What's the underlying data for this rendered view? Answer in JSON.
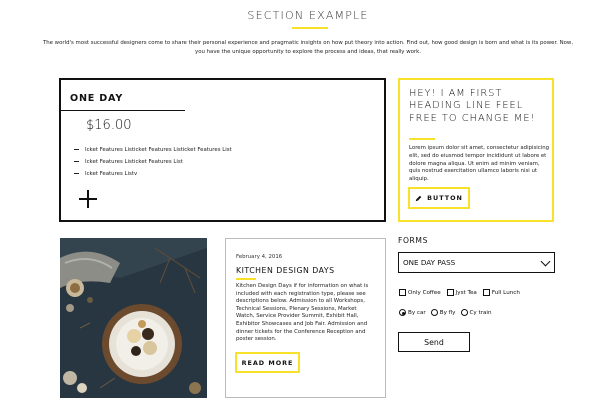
{
  "section": {
    "title": "SECTION EXAMPLE",
    "intro": "The world's most successful designers come to share their personal experience and pragmatic insights on how put theory into action. Find out, how good design is born and what is its power. Now, you have the unique opportunity to explore the process and ideas, that really work."
  },
  "pricing": {
    "title": "ONE DAY",
    "price": "$16.00",
    "features": [
      "Icket Features Listicket Features Listicket Features List",
      "Icket Features Listicket Features List",
      "Icket Features Listv"
    ],
    "plus_icon": "plus-icon"
  },
  "hey": {
    "title": "HEY! I AM FIRST HEADING LINE FEEL FREE TO CHANGE ME!",
    "text": "Lorem ipsum dolor sit amet, consectetur adipisicing elit, sed do eiusmod tempor incididunt ut labore et dolore magna aliqua. Ut enim ad minim veniam, quis nostrud exercitation ullamco laboris nisi ut aliquip.",
    "button_label": "BUTTON",
    "button_icon": "pencil-icon"
  },
  "blog": {
    "date": "February 4, 2016",
    "title": "KITCHEN DESIGN DAYS",
    "text": "Kitchen Design Days if for information on what is included with each registration type, please see descriptions below. Admission to all Workshops, Technical Sessions, Plenary Sessions, Market Watch, Service Provider Summit, Exhibit Hall, Exhibitor Showcases and Job Fair. Admission and dinner tickets for the Conference Reception and poster session.",
    "button_label": "READ MORE"
  },
  "forms": {
    "label": "FORMS",
    "select_value": "ONE DAY PASS",
    "checkboxes": [
      "Only Coffee",
      "Jyst Tea",
      "Full Lunch"
    ],
    "radios": [
      "By car",
      "By fly",
      "Cy train"
    ],
    "radio_selected": 0,
    "send_label": "Send"
  },
  "colors": {
    "accent": "#f7e12b"
  }
}
